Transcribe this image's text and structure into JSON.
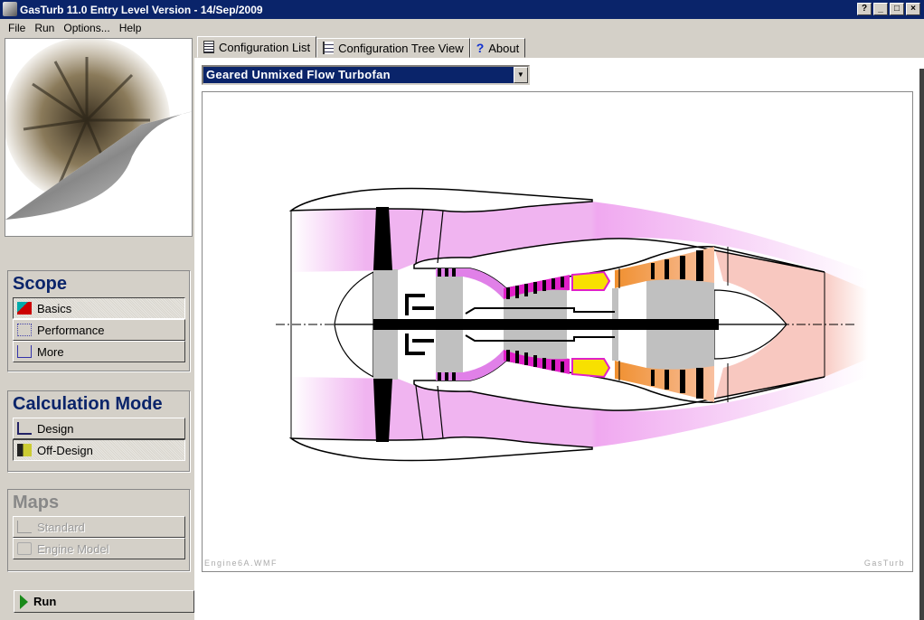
{
  "window": {
    "title": "GasTurb 11.0 Entry Level Version - 14/Sep/2009",
    "buttons": [
      "?",
      "_",
      "□",
      "×"
    ]
  },
  "menu": [
    "File",
    "Run",
    "Options...",
    "Help"
  ],
  "scope": {
    "title": "Scope",
    "items": [
      {
        "label": "Basics",
        "icon": "shapes-icon",
        "selected": true
      },
      {
        "label": "Performance",
        "icon": "performance-icon",
        "selected": false
      },
      {
        "label": "More",
        "icon": "hierarchy-icon",
        "selected": false
      }
    ]
  },
  "calc_mode": {
    "title": "Calculation Mode",
    "items": [
      {
        "label": "Design",
        "icon": "design-icon",
        "selected": false
      },
      {
        "label": "Off-Design",
        "icon": "off-design-icon",
        "selected": true
      }
    ]
  },
  "maps": {
    "title": "Maps",
    "enabled": false,
    "items": [
      {
        "label": "Standard",
        "icon": "chart-icon"
      },
      {
        "label": "Engine Model",
        "icon": "printer-icon"
      }
    ]
  },
  "run": {
    "label": "Run",
    "icon": "play-icon"
  },
  "tabs": [
    {
      "label": "Configuration List",
      "icon": "list-icon",
      "active": true
    },
    {
      "label": "Configuration Tree View",
      "icon": "tree-icon",
      "active": false
    },
    {
      "label": "About",
      "icon": "question-icon",
      "active": false
    }
  ],
  "configuration": {
    "selected": "Geared Unmixed Flow Turbofan"
  },
  "drawing": {
    "filename": "Engine6A.WMF",
    "brand": "GasTurb"
  },
  "colors": {
    "bypass": "#f0b4f0",
    "lpc": "#e080e8",
    "hpc": "#e020c8",
    "combustor": "#f8e800",
    "turbine": "#f0a050",
    "core_jet": "#f8c8c0",
    "titlebar": "#0a246a"
  }
}
